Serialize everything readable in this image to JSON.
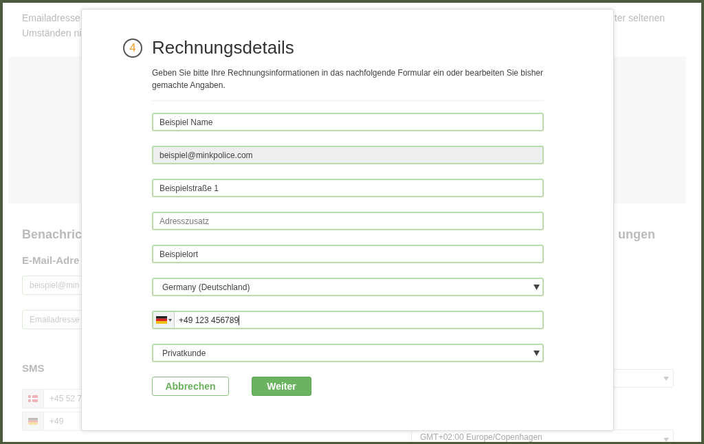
{
  "background": {
    "intro_left": [
      "Emailadresse",
      "Umständen ni"
    ],
    "intro_right": "ter seltenen",
    "heading_left": "Benachric",
    "heading_right": "ungen",
    "subheading": "E-Mail-Adre",
    "email_field": {
      "value": "beispiel@min"
    },
    "email_new_field": {
      "placeholder": "Emailadresse"
    },
    "sms_label": "SMS",
    "sms_numbers": [
      {
        "value": "+45 52 7"
      },
      {
        "value": "+49"
      }
    ],
    "timezone_select": {
      "value": "GMT+02:00 Europe/Copenhagen"
    }
  },
  "dialog": {
    "step": "4",
    "title": "Rechnungsdetails",
    "description": "Geben Sie bitte Ihre Rechnungsinformationen in das nachfolgende Formular ein oder bearbeiten Sie bisher gemachte Angaben.",
    "fields": [
      {
        "kind": "text",
        "value": "Beispiel Name",
        "disabled": false
      },
      {
        "kind": "text",
        "value": "beispiel@minkpolice.com",
        "disabled": true
      },
      {
        "kind": "text",
        "value": "Beispielstraße 1",
        "disabled": false
      },
      {
        "kind": "text",
        "placeholder": "Adresszusatz",
        "disabled": false
      },
      {
        "kind": "text",
        "value": "Beispielort",
        "disabled": false
      },
      {
        "kind": "select",
        "value": "Germany (Deutschland)"
      },
      {
        "kind": "phone",
        "value": "+49 123 456789"
      },
      {
        "kind": "select",
        "value": "Privatkunde"
      }
    ],
    "buttons": [
      {
        "kind": "secondary",
        "label": "Abbrechen"
      },
      {
        "kind": "primary",
        "label": "Weiter"
      }
    ]
  }
}
